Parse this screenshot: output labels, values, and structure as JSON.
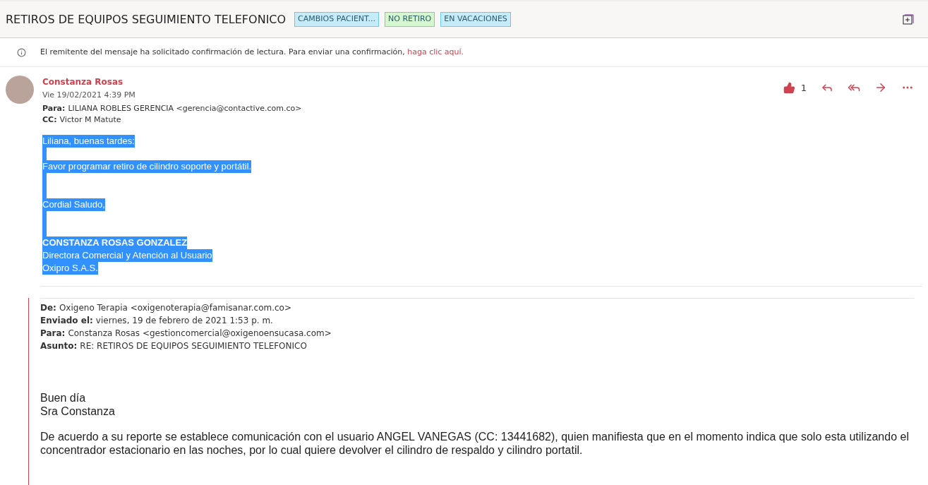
{
  "subject": {
    "title": "RETIROS DE EQUIPOS SEGUIMIENTO TELEFONICO",
    "tags": [
      {
        "label": "CAMBIOS PACIENT...",
        "color": "#c7ecf9"
      },
      {
        "label": "NO RETIRO",
        "color": "#d4f7cf"
      },
      {
        "label": "EN VACACIONES",
        "color": "#c7ecf9"
      }
    ]
  },
  "read_receipt": {
    "text": "El remitente del mensaje ha solicitado confirmación de lectura. Para enviar una confirmación,",
    "link": "haga clic aquí."
  },
  "message": {
    "sender": "Constanza Rosas",
    "date": "Vie 19/02/2021 4:39 PM",
    "to_label": "Para:",
    "to": "LILIANA ROBLES GERENCIA <gerencia@contactive.com.co>",
    "cc_label": "CC:",
    "cc": "Victor M Matute",
    "likes": "1",
    "body_selected": true,
    "body": [
      {
        "kind": "text",
        "text": "Liliana, buenas tardes:"
      },
      {
        "kind": "blank"
      },
      {
        "kind": "text",
        "text": "Favor programar retiro de cilindro soporte y portátil."
      },
      {
        "kind": "blank"
      },
      {
        "kind": "blank"
      },
      {
        "kind": "text",
        "text": "Cordial Saludo,"
      },
      {
        "kind": "blank"
      },
      {
        "kind": "blank"
      },
      {
        "kind": "bold",
        "text": "CONSTANZA ROSAS GONZALEZ"
      },
      {
        "kind": "text",
        "text": "Directora Comercial y Atención al Usuario"
      },
      {
        "kind": "text",
        "text": "Oxipro S.A.S."
      }
    ]
  },
  "quoted": {
    "headers": [
      {
        "label": "De:",
        "value": "Oxigeno Terapia <oxigenoterapia@famisanar.com.co>"
      },
      {
        "label": "Enviado el:",
        "value": "viernes, 19 de febrero de 2021 1:53 p. m."
      },
      {
        "label": "Para:",
        "value": "Constanza Rosas <gestioncomercial@oxigenoensucasa.com>"
      },
      {
        "label": "Asunto:",
        "value": "RE: RETIROS DE EQUIPOS SEGUIMIENTO TELEFONICO"
      }
    ],
    "greeting": [
      "Buen día",
      "Sra Constanza"
    ],
    "paragraph": "De acuerdo a su reporte se establece comunicación con el usuario ANGEL VANEGAS (CC: 13441682), quien manifiesta que en el momento indica que solo esta utilizando el concentrador estacionario en las noches, por lo cual quiere devolver el cilindro de respaldo y cilindro portatil."
  }
}
